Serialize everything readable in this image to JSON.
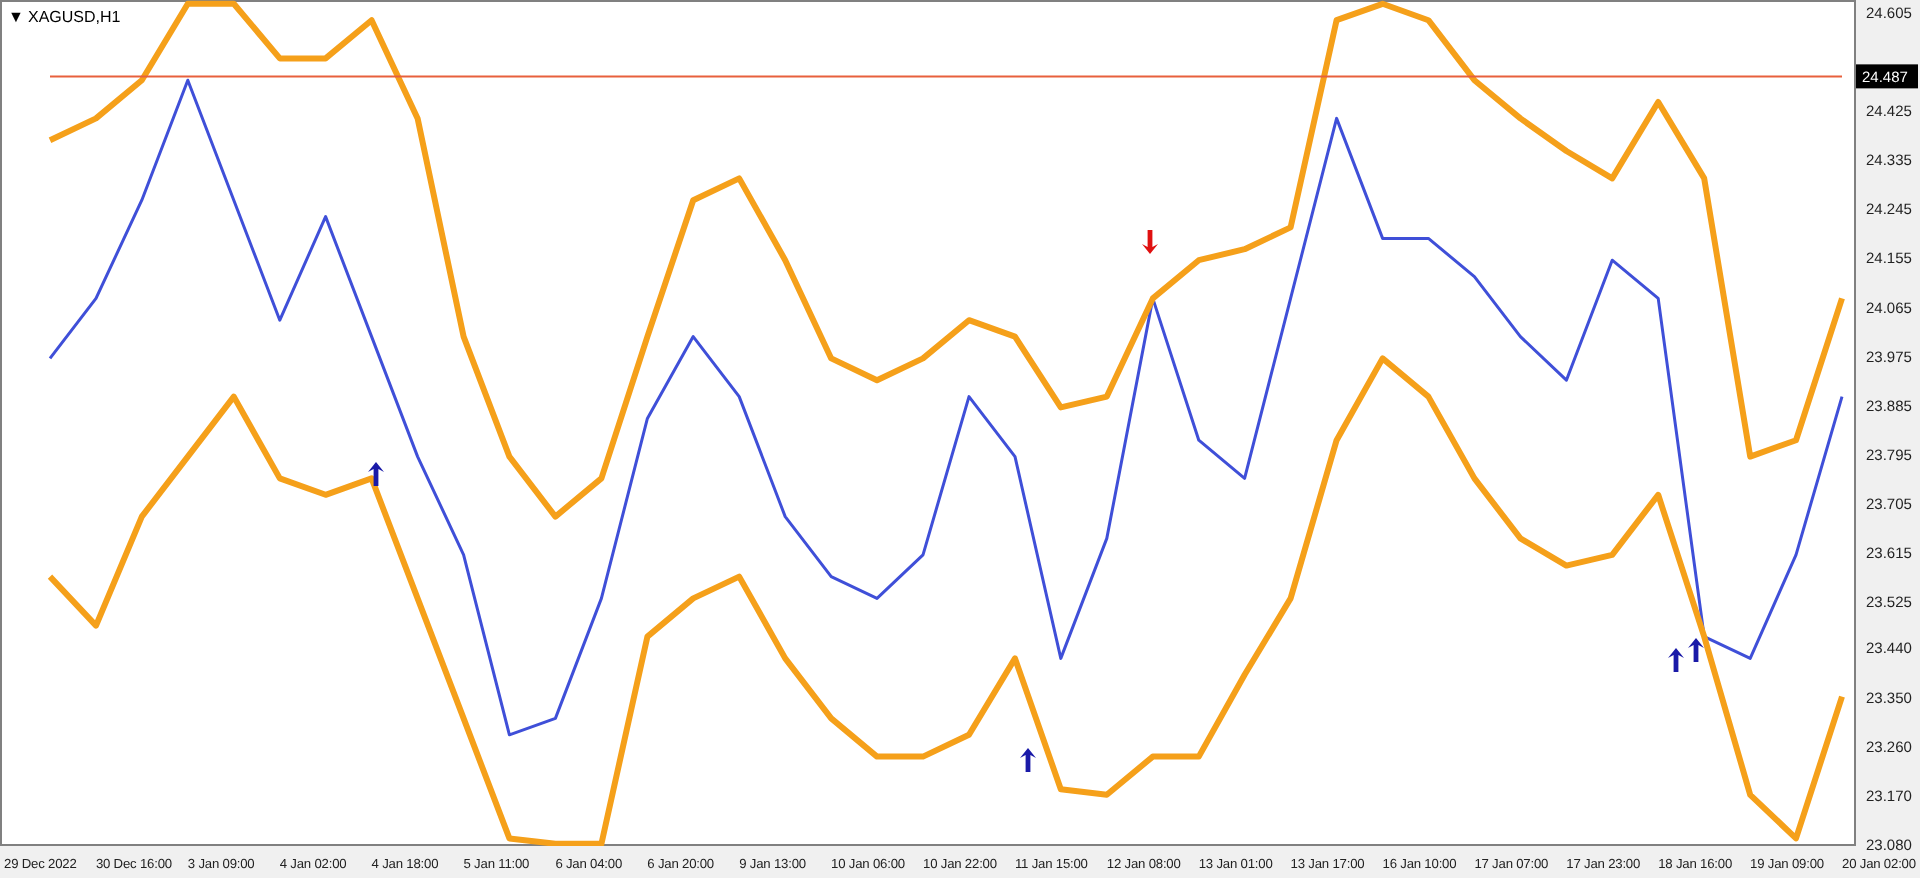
{
  "chart": {
    "title_marker": "▼",
    "title": "XAGUSD,H1",
    "chart_data": {
      "type": "line",
      "categories": [
        "29 Dec 2022",
        null,
        "30 Dec 16:00",
        null,
        "3 Jan 09:00",
        null,
        "4 Jan 02:00",
        null,
        "4 Jan 18:00",
        null,
        "5 Jan 11:00",
        null,
        "6 Jan 04:00",
        null,
        "6 Jan 20:00",
        null,
        "9 Jan 13:00",
        null,
        "10 Jan 06:00",
        null,
        "10 Jan 22:00",
        null,
        "11 Jan 15:00",
        null,
        "12 Jan 08:00",
        null,
        "13 Jan 01:00",
        null,
        "13 Jan 17:00",
        null,
        "16 Jan 10:00",
        null,
        "17 Jan 07:00",
        null,
        "17 Jan 23:00",
        null,
        "18 Jan 16:00",
        null,
        "19 Jan 09:00",
        null,
        "20 Jan 02:00"
      ],
      "series": [
        {
          "color": "#3f4fd8",
          "values": [
            23.97,
            24.08,
            24.26,
            24.48,
            24.26,
            24.04,
            24.23,
            24.01,
            23.79,
            23.61,
            23.28,
            23.31,
            23.53,
            23.86,
            24.01,
            23.9,
            23.68,
            23.57,
            23.53,
            23.61,
            23.9,
            23.79,
            23.42,
            23.64,
            24.08,
            23.82,
            23.75,
            24.08,
            24.41,
            24.19,
            24.19,
            24.12,
            24.01,
            23.93,
            24.15,
            24.08,
            23.46,
            23.42,
            23.61,
            23.9,
            null
          ]
        },
        {
          "color": "#f5a01a",
          "values": [
            24.37,
            24.41,
            24.48,
            24.62,
            24.62,
            24.52,
            24.52,
            24.59,
            24.41,
            24.01,
            23.79,
            23.68,
            23.75,
            24.01,
            24.26,
            24.3,
            24.15,
            23.97,
            23.93,
            23.97,
            24.04,
            24.01,
            23.88,
            23.9,
            24.08,
            24.15,
            24.17,
            24.21,
            24.59,
            24.62,
            24.59,
            24.48,
            24.41,
            24.35,
            24.3,
            24.44,
            24.3,
            23.79,
            23.82,
            24.08,
            null
          ]
        },
        {
          "color": "#e8603c",
          "values": [
            24.487,
            24.487,
            24.487,
            24.487,
            24.487,
            24.487,
            24.487,
            24.487,
            24.487,
            24.487,
            24.487,
            24.487,
            24.487,
            24.487,
            24.487,
            24.487,
            24.487,
            24.487,
            24.487,
            24.487,
            24.487,
            24.487,
            24.487,
            24.487,
            24.487,
            24.487,
            24.487,
            24.487,
            24.487,
            24.487,
            24.487,
            24.487,
            24.487,
            24.487,
            24.487,
            24.487,
            24.487,
            24.487,
            24.487,
            24.487,
            null
          ]
        },
        {
          "color": "#f5a01a",
          "values": [
            23.57,
            23.48,
            23.68,
            23.79,
            23.9,
            23.75,
            23.72,
            23.75,
            23.53,
            23.31,
            23.09,
            23.08,
            23.08,
            23.46,
            23.53,
            23.57,
            23.42,
            23.31,
            23.24,
            23.24,
            23.28,
            23.42,
            23.18,
            23.17,
            23.24,
            23.24,
            23.39,
            23.53,
            23.82,
            23.97,
            23.9,
            23.75,
            23.64,
            23.59,
            23.61,
            23.72,
            23.46,
            23.17,
            23.09,
            23.35,
            null
          ]
        }
      ],
      "ylim": [
        23.076,
        24.627
      ],
      "yticks": [
        {
          "value": 24.605,
          "label": "24.605"
        },
        {
          "value": 24.425,
          "label": "24.425"
        },
        {
          "value": 24.335,
          "label": "24.335"
        },
        {
          "value": 24.245,
          "label": "24.245"
        },
        {
          "value": 24.155,
          "label": "24.155"
        },
        {
          "value": 24.065,
          "label": "24.065"
        },
        {
          "value": 23.975,
          "label": "23.975"
        },
        {
          "value": 23.885,
          "label": "23.885"
        },
        {
          "value": 23.795,
          "label": "23.795"
        },
        {
          "value": 23.705,
          "label": "23.705"
        },
        {
          "value": 23.615,
          "label": "23.615"
        },
        {
          "value": 23.525,
          "label": "23.525"
        },
        {
          "value": 23.44,
          "label": "23.440"
        },
        {
          "value": 23.35,
          "label": "23.350"
        },
        {
          "value": 23.26,
          "label": "23.260"
        },
        {
          "value": 23.17,
          "label": "23.170"
        },
        {
          "value": 23.08,
          "label": "23.080"
        }
      ],
      "stacked": false
    }
  },
  "price_label": "24.487"
}
